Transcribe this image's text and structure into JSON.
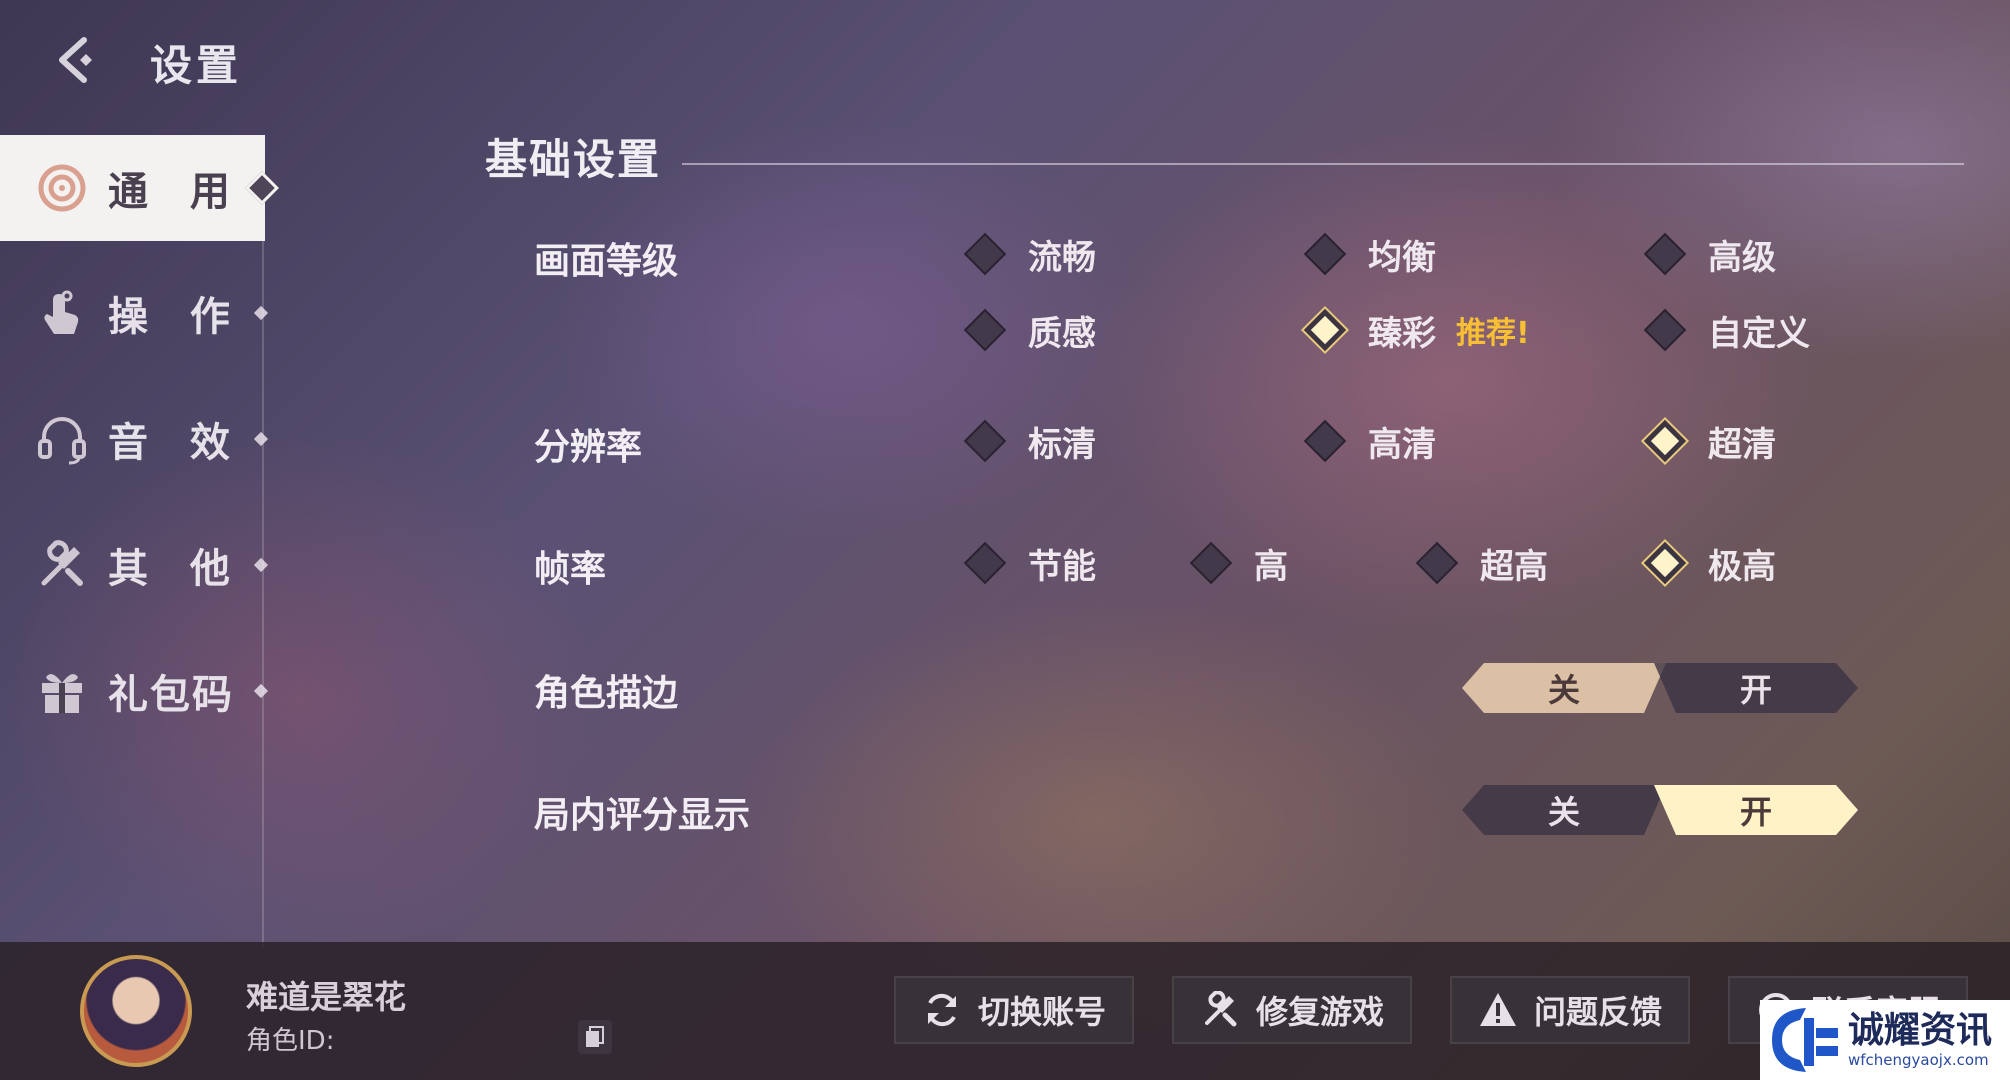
{
  "header": {
    "title": "设置"
  },
  "sidebar": {
    "items": [
      {
        "label": "通 用",
        "icon": "general-icon",
        "active": true
      },
      {
        "label": "操 作",
        "icon": "touch-icon",
        "active": false
      },
      {
        "label": "音 效",
        "icon": "headphones-icon",
        "active": false
      },
      {
        "label": "其 他",
        "icon": "tools-icon",
        "active": false
      },
      {
        "label": "礼包码",
        "icon": "gift-icon",
        "active": false
      }
    ]
  },
  "section": {
    "title": "基础设置"
  },
  "settings": {
    "quality": {
      "label": "画面等级",
      "options": [
        "流畅",
        "均衡",
        "高级",
        "质感",
        "臻彩",
        "自定义"
      ],
      "selected": "臻彩",
      "badge": "推荐!"
    },
    "resolution": {
      "label": "分辨率",
      "options": [
        "标清",
        "高清",
        "超清"
      ],
      "selected": "超清"
    },
    "framerate": {
      "label": "帧率",
      "options": [
        "节能",
        "高",
        "超高",
        "极高"
      ],
      "selected": "极高"
    },
    "outline": {
      "label": "角色描边",
      "off_label": "关",
      "on_label": "开",
      "value": "关"
    },
    "score": {
      "label": "局内评分显示",
      "off_label": "关",
      "on_label": "开",
      "value": "开"
    }
  },
  "footer": {
    "player_name": "难道是翠花",
    "role_id_label": "角色ID:",
    "buttons": [
      {
        "label": "切换账号",
        "icon": "refresh-icon"
      },
      {
        "label": "修复游戏",
        "icon": "repair-icon"
      },
      {
        "label": "问题反馈",
        "icon": "warning-icon"
      },
      {
        "label": "联系客服",
        "icon": "support-icon"
      }
    ]
  },
  "watermark": {
    "text": "诚耀资讯",
    "url": "wfchengyaojx.com"
  },
  "colors": {
    "accent_gold": "#f6bf34",
    "toggle_warm": "#dcc0a6",
    "toggle_bright": "#fff2c6",
    "selected_diamond": "#fff3c9"
  }
}
